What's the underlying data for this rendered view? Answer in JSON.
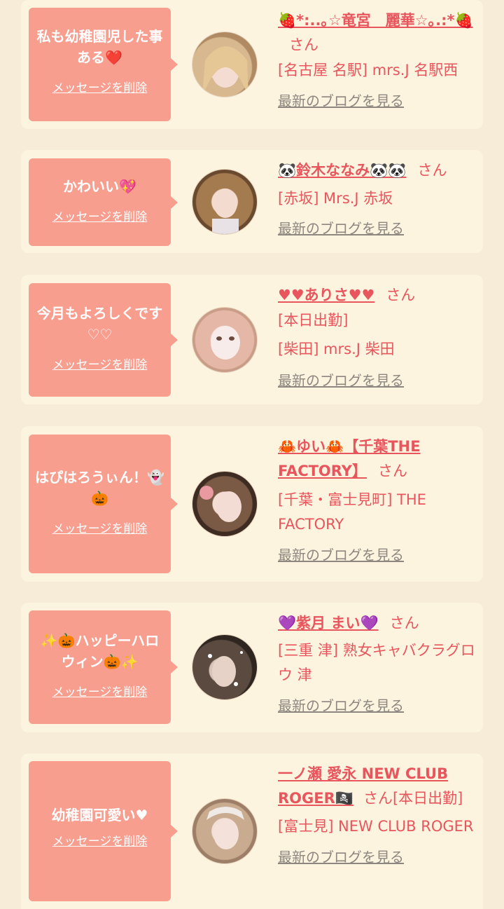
{
  "common": {
    "delete_label": "メッセージを削除",
    "blog_label": "最新のブログを見る",
    "san": "さん"
  },
  "cards": [
    {
      "message": "私も幼稚園児した事ある❤️",
      "name": "🍓*:..｡☆竜宮　麗華☆｡.:*🍓",
      "lines": [
        "[名古屋 名駅] mrs.J 名駅西"
      ]
    },
    {
      "message": "かわいい💖",
      "name": "🐼鈴木ななみ🐼🐼",
      "lines": [
        "[赤坂] Mrs.J 赤坂"
      ]
    },
    {
      "message": "今月もよろしくです♡♡",
      "name": "♥♥ありさ♥♥",
      "lines": [
        "[本日出勤]",
        "[柴田] mrs.J 柴田"
      ]
    },
    {
      "message": "はぴはろうぃん！👻🎃",
      "name": "🦀ゆい🦀【千葉THE FACTORY】",
      "lines": [
        "[千葉・富士見町] THE FACTORY"
      ]
    },
    {
      "message": "✨🎃ハッピーハロウィン🎃✨",
      "name": "💜紫月 まい💜",
      "lines": [
        "[三重 津] 熟女キャバクラグロウ 津"
      ]
    },
    {
      "message": "幼稚園可愛い♥",
      "name": "一ノ瀬 愛永 NEW CLUB ROGER🏴‍☠️",
      "san_suffix": "[本日出勤]",
      "lines": [
        "[富士見] NEW CLUB ROGER"
      ]
    }
  ]
}
